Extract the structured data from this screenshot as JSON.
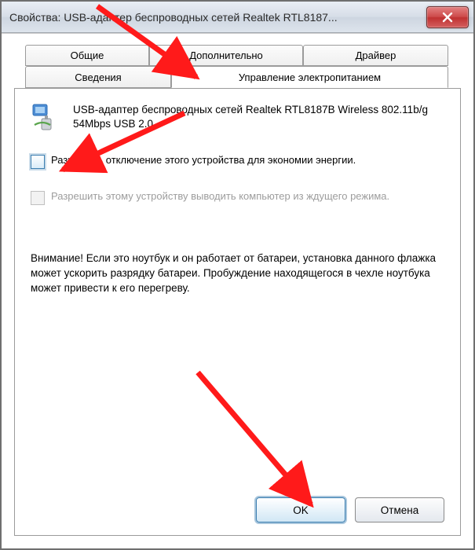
{
  "window": {
    "title": "Свойства: USB-адаптер беспроводных сетей Realtek RTL8187..."
  },
  "tabs": {
    "general": "Общие",
    "advanced": "Дополнительно",
    "driver": "Драйвер",
    "details": "Сведения",
    "power": "Управление электропитанием"
  },
  "device": {
    "name": "USB-адаптер беспроводных сетей Realtek RTL8187B Wireless 802.11b/g 54Mbps USB 2.0"
  },
  "options": {
    "allow_off_label": "Разрешить отключение этого устройства для экономии энергии.",
    "allow_wake_label": "Разрешить этому устройству выводить компьютер из ждущего режима."
  },
  "warning_text": "Внимание! Если это ноутбук и он работает от батареи, установка данного флажка может ускорить разрядку батареи. Пробуждение находящегося в чехле ноутбука может привести к его перегреву.",
  "buttons": {
    "ok": "OK",
    "cancel": "Отмена"
  }
}
